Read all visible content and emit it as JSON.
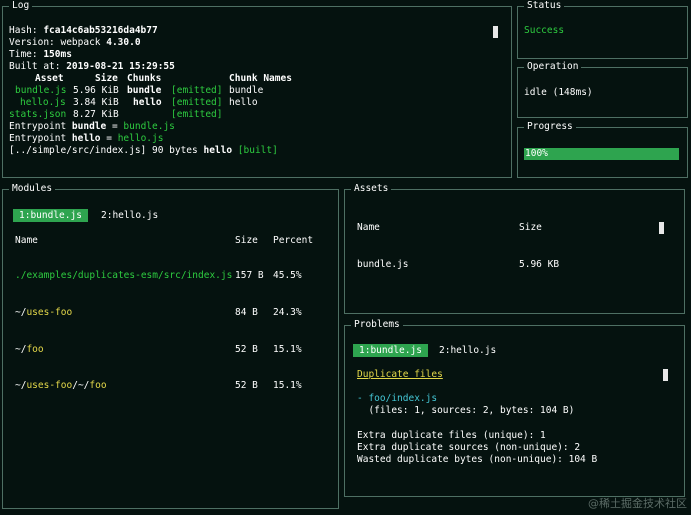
{
  "log": {
    "title": "Log",
    "hash_label": "Hash: ",
    "hash_value": "fca14c6ab53216da4b77",
    "version_label": "Version: webpack ",
    "version_value": "4.30.0",
    "time_label": "Time: ",
    "time_value": "150ms",
    "built_label": "Built at: ",
    "built_value": "2019-08-21 15:29:55",
    "headers": {
      "asset": "Asset",
      "size": "Size",
      "chunks": "Chunks",
      "chunk_names": "Chunk Names"
    },
    "assets": [
      {
        "asset": "bundle.js",
        "size": "5.96 KiB",
        "chunks": "bundle",
        "emitted": "[emitted]",
        "chunk_names": "bundle"
      },
      {
        "asset": "hello.js",
        "size": "3.84 KiB",
        "chunks": "hello",
        "emitted": "[emitted]",
        "chunk_names": "hello"
      },
      {
        "asset": "stats.json",
        "size": "8.27 KiB",
        "chunks": "",
        "emitted": "[emitted]",
        "chunk_names": ""
      }
    ],
    "entry1_label": "Entrypoint ",
    "entry1_name": "bundle",
    "entry1_eq": " = ",
    "entry1_file": "bundle.js",
    "entry2_label": "Entrypoint ",
    "entry2_name": "hello",
    "entry2_eq": " = ",
    "entry2_file": "hello.js",
    "module_path": "[../simple/src/index.js] 90 bytes ",
    "module_chunk": "hello",
    "module_built": " [built]"
  },
  "status": {
    "title": "Status",
    "value": "Success"
  },
  "operation": {
    "title": "Operation",
    "value": "idle (148ms)"
  },
  "progress": {
    "title": "Progress",
    "label": "100%",
    "fraction": 1.0
  },
  "modules": {
    "title": "Modules",
    "tabs": [
      "1:bundle.js",
      "2:hello.js"
    ],
    "headers": {
      "name": "Name",
      "size": "Size",
      "percent": "Percent"
    },
    "rows": [
      {
        "name": "./examples/duplicates-esm/src/index.js",
        "size": "157 B",
        "percent": "45.5%"
      },
      {
        "name_prefix": "~/",
        "name": "uses-foo",
        "size": "84 B",
        "percent": "24.3%"
      },
      {
        "name_prefix": "~/",
        "name": "foo",
        "size": "52 B",
        "percent": "15.1%"
      },
      {
        "name_prefix": "~/",
        "name": "uses-foo",
        "name_mid": "/~/",
        "name2": "foo",
        "size": "52 B",
        "percent": "15.1%"
      }
    ]
  },
  "assets_panel": {
    "title": "Assets",
    "headers": {
      "name": "Name",
      "size": "Size"
    },
    "rows": [
      {
        "name": "bundle.js",
        "size": "5.96 KB"
      }
    ]
  },
  "problems": {
    "title": "Problems",
    "tabs": [
      "1:bundle.js",
      "2:hello.js"
    ],
    "heading": "Duplicate files",
    "item_dash": "- ",
    "item_path": "foo/index.js",
    "item_detail": "  (files: 1, sources: 2, bytes: 104 B)",
    "summary": [
      "Extra duplicate files (unique): 1",
      "Extra duplicate sources (non-unique): 2",
      "Wasted duplicate bytes (non-unique): 104 B"
    ]
  },
  "watermark": "@稀土掘金技术社区"
}
